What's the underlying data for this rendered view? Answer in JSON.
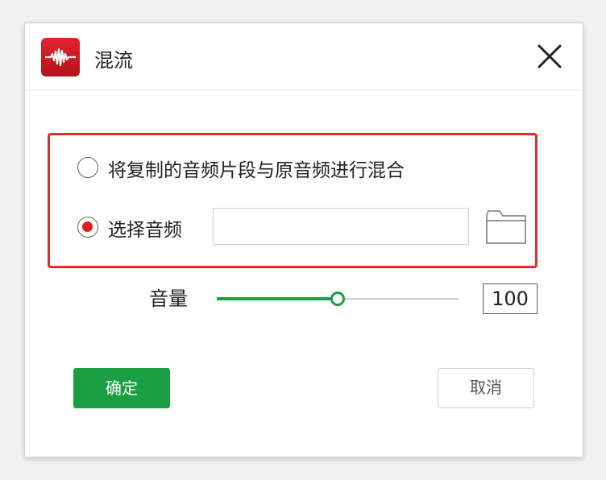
{
  "window": {
    "title": "混流",
    "app_icon": "audio-waveform-icon",
    "close_icon": "close-icon"
  },
  "options": {
    "mix_clip_label": "将复制的音频片段与原音频进行混合",
    "mix_clip_selected": false,
    "select_audio_label": "选择音频",
    "select_audio_selected": true,
    "file_path_value": "",
    "browse_icon": "folder-icon"
  },
  "volume": {
    "label": "音量",
    "value": "100",
    "slider_level": 0.5
  },
  "buttons": {
    "ok_label": "确定",
    "cancel_label": "取消"
  },
  "colors": {
    "accent_green": "#1aa042",
    "highlight_red": "#e52b2b",
    "radio_red": "#e21d1d"
  }
}
